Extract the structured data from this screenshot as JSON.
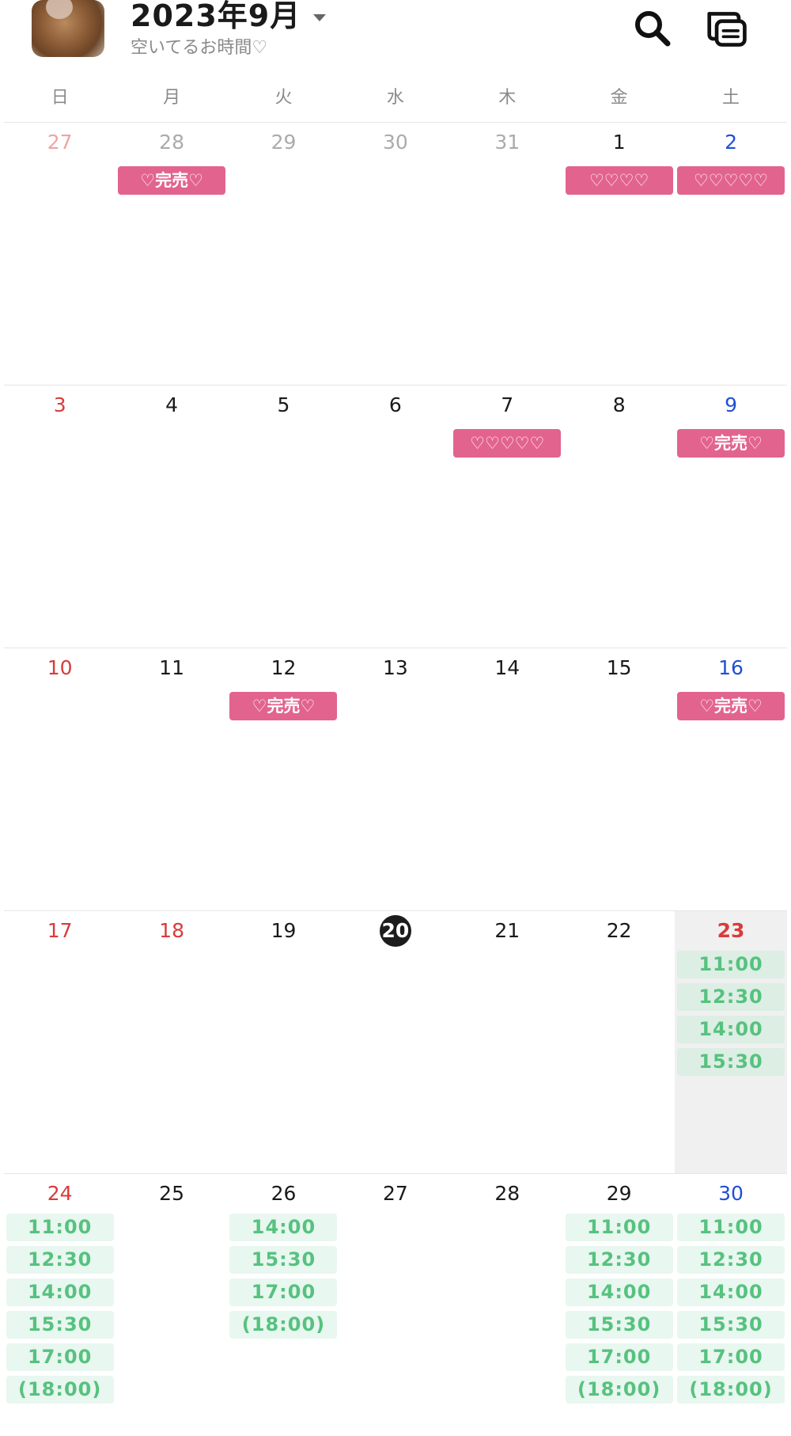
{
  "header": {
    "title": "2023年9月",
    "subtitle": "空いてるお時間♡"
  },
  "icons": {
    "search": "search-icon",
    "chat": "chat-list-icon",
    "caret": "caret-down-icon"
  },
  "weekdays": [
    "日",
    "月",
    "火",
    "水",
    "木",
    "金",
    "土"
  ],
  "colors": {
    "badge": "#e2648e",
    "slot_bg": "#e8f7ef",
    "slot_text": "#56c27f",
    "sunday": "#d93b3b",
    "saturday": "#1f4fd6",
    "today_bg": "#1c1c1c"
  },
  "weeks": [
    {
      "days": [
        {
          "num": "27",
          "style": "other-sun",
          "badge": "",
          "slots": []
        },
        {
          "num": "28",
          "style": "other",
          "badge": "♡完売♡",
          "slots": []
        },
        {
          "num": "29",
          "style": "other",
          "badge": "",
          "slots": []
        },
        {
          "num": "30",
          "style": "other",
          "badge": "",
          "slots": []
        },
        {
          "num": "31",
          "style": "other",
          "badge": "",
          "slots": []
        },
        {
          "num": "1",
          "style": "normal",
          "badge": "♡♡♡♡",
          "slots": []
        },
        {
          "num": "2",
          "style": "sat",
          "badge": "♡♡♡♡♡",
          "slots": []
        }
      ]
    },
    {
      "days": [
        {
          "num": "3",
          "style": "sun",
          "badge": "",
          "slots": []
        },
        {
          "num": "4",
          "style": "normal",
          "badge": "",
          "slots": []
        },
        {
          "num": "5",
          "style": "normal",
          "badge": "",
          "slots": []
        },
        {
          "num": "6",
          "style": "normal",
          "badge": "",
          "slots": []
        },
        {
          "num": "7",
          "style": "normal",
          "badge": "♡♡♡♡♡",
          "slots": []
        },
        {
          "num": "8",
          "style": "normal",
          "badge": "",
          "slots": []
        },
        {
          "num": "9",
          "style": "sat",
          "badge": "♡完売♡",
          "slots": []
        }
      ]
    },
    {
      "days": [
        {
          "num": "10",
          "style": "sun",
          "badge": "",
          "slots": []
        },
        {
          "num": "11",
          "style": "normal",
          "badge": "",
          "slots": []
        },
        {
          "num": "12",
          "style": "normal",
          "badge": "♡完売♡",
          "slots": []
        },
        {
          "num": "13",
          "style": "normal",
          "badge": "",
          "slots": []
        },
        {
          "num": "14",
          "style": "normal",
          "badge": "",
          "slots": []
        },
        {
          "num": "15",
          "style": "normal",
          "badge": "",
          "slots": []
        },
        {
          "num": "16",
          "style": "sat",
          "badge": "♡完売♡",
          "slots": []
        }
      ]
    },
    {
      "days": [
        {
          "num": "17",
          "style": "sun",
          "badge": "",
          "slots": []
        },
        {
          "num": "18",
          "style": "holiday",
          "badge": "",
          "slots": []
        },
        {
          "num": "19",
          "style": "normal",
          "badge": "",
          "slots": []
        },
        {
          "num": "20",
          "style": "today",
          "badge": "",
          "slots": []
        },
        {
          "num": "21",
          "style": "normal",
          "badge": "",
          "slots": []
        },
        {
          "num": "22",
          "style": "normal",
          "badge": "",
          "slots": []
        },
        {
          "num": "23",
          "style": "holiday-bold",
          "shaded": true,
          "badge": "",
          "slots": [
            "11:00",
            "12:30",
            "14:00",
            "15:30"
          ]
        }
      ]
    },
    {
      "days": [
        {
          "num": "24",
          "style": "sun",
          "badge": "",
          "slots": [
            "11:00",
            "12:30",
            "14:00",
            "15:30",
            "17:00",
            "(18:00)"
          ]
        },
        {
          "num": "25",
          "style": "normal",
          "badge": "",
          "slots": []
        },
        {
          "num": "26",
          "style": "normal",
          "badge": "",
          "slots": [
            "14:00",
            "15:30",
            "17:00",
            "(18:00)"
          ]
        },
        {
          "num": "27",
          "style": "normal",
          "badge": "",
          "slots": []
        },
        {
          "num": "28",
          "style": "normal",
          "badge": "",
          "slots": []
        },
        {
          "num": "29",
          "style": "normal",
          "badge": "",
          "slots": [
            "11:00",
            "12:30",
            "14:00",
            "15:30",
            "17:00",
            "(18:00)"
          ]
        },
        {
          "num": "30",
          "style": "sat",
          "badge": "",
          "slots": [
            "11:00",
            "12:30",
            "14:00",
            "15:30",
            "17:00",
            "(18:00)"
          ]
        }
      ]
    }
  ]
}
